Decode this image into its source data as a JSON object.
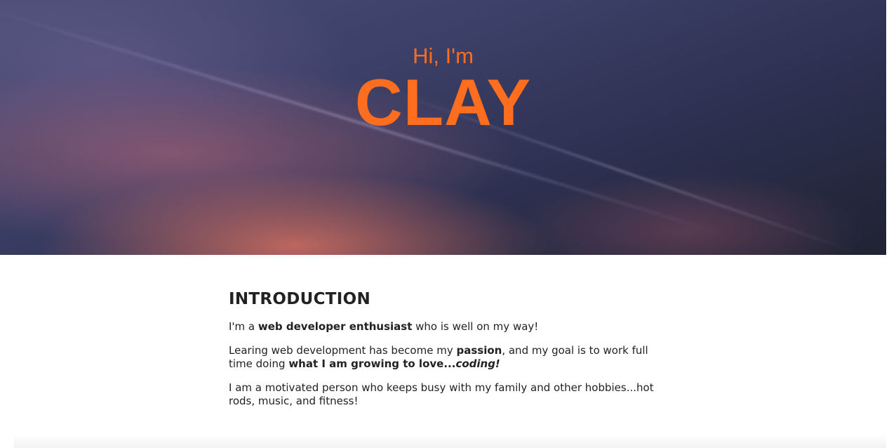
{
  "hero": {
    "greeting": "Hi, I'm",
    "name": "CLAY",
    "accent_color": "#ff6d1f"
  },
  "introduction": {
    "heading": "INTRODUCTION",
    "p1": {
      "a": "I'm a ",
      "b": "web developer enthusiast",
      "c": " who is well on my way!"
    },
    "p2": {
      "a": "Learing web development has become my ",
      "b": "passion",
      "c": ", and my goal is to work full time doing ",
      "d": "what I am growing to love...",
      "e": "coding!"
    },
    "p3": "I am a motivated person who keeps busy with my family and other hobbies...hot rods, music, and fitness!"
  }
}
